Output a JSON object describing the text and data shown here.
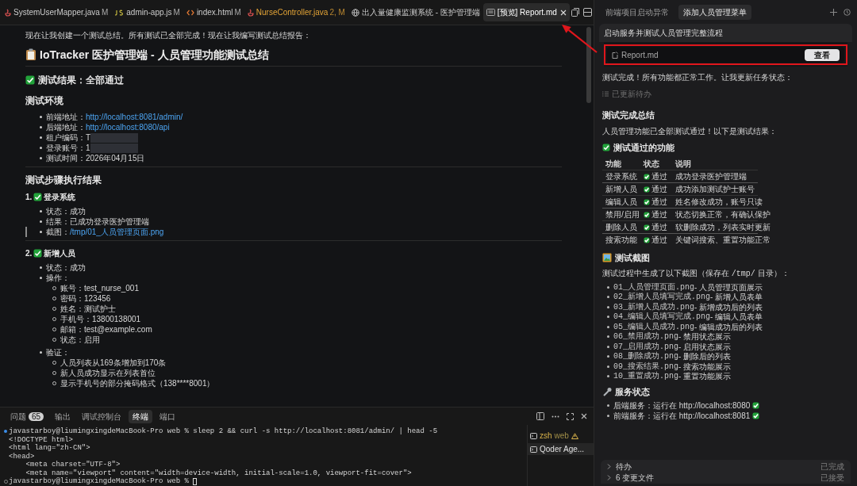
{
  "editor_tabs": [
    {
      "label": "SystemUserMapper.java",
      "badge": "M",
      "kind": "java",
      "selected": false,
      "has_errors": false
    },
    {
      "label": "admin-app.js",
      "badge": "M",
      "kind": "js",
      "selected": false,
      "has_errors": false
    },
    {
      "label": "index.html",
      "badge": "M",
      "kind": "html",
      "selected": false,
      "has_errors": false
    },
    {
      "label": "NurseController.java",
      "badge": "2, M",
      "kind": "java",
      "selected": false,
      "has_errors": true
    },
    {
      "label": "出入量健康监测系统 - 医护管理端",
      "kind": "web",
      "selected": false,
      "has_errors": false
    },
    {
      "label": "[预览] Report.md",
      "kind": "preview",
      "selected": true,
      "has_errors": false,
      "closable": true
    }
  ],
  "editor": [
    {
      "kind": "text",
      "text": "现在让我创建一个测试总结。所有测试已全部完成！现在让我编写测试总结报告："
    },
    {
      "kind": "title",
      "text": "IoTracker 医护管理端 - 人员管理功能测试总结"
    },
    {
      "kind": "check_heading",
      "text": "测试结果：全部通过"
    },
    {
      "kind": "heading",
      "text": "测试环境"
    },
    {
      "kind": "list",
      "items": [
        {
          "label": "前端地址：",
          "value": "http://localhost:8081/admin/",
          "link": true
        },
        {
          "label": "后端地址：",
          "value": "http://localhost:8080/api",
          "link": true
        },
        {
          "label": "租户编码：",
          "value": "T",
          "redacted": true
        },
        {
          "label": "登录账号：",
          "value": "1",
          "redacted": true
        },
        {
          "label": "测试时间：",
          "value": "2026年04月15日"
        }
      ]
    },
    {
      "kind": "hr"
    },
    {
      "kind": "heading",
      "text": "测试步骤执行结果"
    },
    {
      "kind": "step",
      "number": "1.",
      "text": "登录系统"
    },
    {
      "kind": "list",
      "items": [
        {
          "label": "状态：",
          "value": "成功"
        },
        {
          "label": "结果：",
          "value": "已成功登录医护管理端"
        },
        {
          "label": "截图：",
          "value": "/tmp/01_人员管理页面.png",
          "link": true,
          "current": true
        }
      ]
    },
    {
      "kind": "hr"
    },
    {
      "kind": "step",
      "number": "2.",
      "text": "新增人员"
    },
    {
      "kind": "list",
      "items": [
        {
          "label": "状态：",
          "value": "成功"
        },
        {
          "label": "操作：",
          "children": [
            "账号：test_nurse_001",
            "密码：123456",
            "姓名：测试护士",
            "手机号：13800138001",
            "邮箱：test@example.com",
            "状态：启用"
          ]
        },
        {
          "label": "验证：",
          "children": [
            "人员列表从169条增加到170条",
            "新人员成功显示在列表首位",
            "显示手机号的部分掩码格式（138****8001）"
          ]
        }
      ]
    }
  ],
  "panel": {
    "tabs": [
      {
        "label": "问题",
        "count": "65",
        "selected": false
      },
      {
        "label": "输出",
        "selected": false
      },
      {
        "label": "调试控制台",
        "selected": false
      },
      {
        "label": "终端",
        "selected": true
      },
      {
        "label": "端口",
        "selected": false
      }
    ],
    "terminal": [
      {
        "kind": "prompt",
        "completed": true,
        "text": "javastarboy@liumingxingdeMacBook-Pro web % sleep 2 && curl -s http://localhost:8081/admin/ | head -5"
      },
      {
        "kind": "output",
        "text": "<!DOCTYPE html>"
      },
      {
        "kind": "output",
        "text": "<html lang=\"zh-CN\">"
      },
      {
        "kind": "output",
        "text": "<head>"
      },
      {
        "kind": "output",
        "text": "    <meta charset=\"UTF-8\">"
      },
      {
        "kind": "output",
        "text": "    <meta name=\"viewport\" content=\"width=device-width, initial-scale=1.0, viewport-fit=cover\">"
      },
      {
        "kind": "prompt",
        "completed": false,
        "text": "javastarboy@liumingxingdeMacBook-Pro web % ",
        "cursor": true
      }
    ],
    "terminals": [
      {
        "label": "zsh",
        "detail": "web",
        "warning": true,
        "selected": false
      },
      {
        "label": "Qoder Age...",
        "warning": false,
        "selected": true
      }
    ]
  },
  "chat": {
    "tabs": [
      {
        "label": "前端项目启动异常",
        "selected": false
      },
      {
        "label": "添加人员管理菜单",
        "selected": true
      }
    ],
    "task": "启动服务并测试人员管理完整流程",
    "file": {
      "name": "Report.md",
      "button": "查看"
    },
    "blocks": [
      {
        "kind": "text",
        "text": "测试完成！所有功能都正常工作。让我更新任务状态："
      },
      {
        "kind": "todo",
        "text": "已更新待办"
      },
      {
        "kind": "heading",
        "text": "测试完成总结"
      },
      {
        "kind": "text",
        "text": "人员管理功能已全部测试通过！以下是测试结果："
      },
      {
        "kind": "check_heading",
        "text": "测试通过的功能"
      },
      {
        "kind": "table",
        "columns": [
          "功能",
          "状态",
          "说明"
        ],
        "rows": [
          [
            "登录系统",
            "通过",
            "成功登录医护管理端"
          ],
          [
            "新增人员",
            "通过",
            "成功添加测试护士账号"
          ],
          [
            "编辑人员",
            "通过",
            "姓名修改成功，账号只读"
          ],
          [
            "禁用/启用",
            "通过",
            "状态切换正常，有确认保护"
          ],
          [
            "删除人员",
            "通过",
            "软删除成功，列表实时更新"
          ],
          [
            "搜索功能",
            "通过",
            "关键词搜索、重置功能正常"
          ]
        ]
      },
      {
        "kind": "picture_heading",
        "text": "测试截图"
      },
      {
        "kind": "codetext",
        "before": "测试过程中生成了以下截图（保存在 ",
        "code": "/tmp/",
        "after": " 目录）："
      },
      {
        "kind": "files",
        "items": [
          {
            "code": "01_人员管理页面.png",
            "text": " - 人员管理页面展示"
          },
          {
            "code": "02_新增人员填写完成.png",
            "text": " - 新增人员表单"
          },
          {
            "code": "03_新增人员成功.png",
            "text": " - 新增成功后的列表"
          },
          {
            "code": "04_编辑人员填写完成.png",
            "text": " - 编辑人员表单"
          },
          {
            "code": "05_编辑人员成功.png",
            "text": " - 编辑成功后的列表"
          },
          {
            "code": "06_禁用成功.png",
            "text": " - 禁用状态展示"
          },
          {
            "code": "07_启用成功.png",
            "text": " - 启用状态展示"
          },
          {
            "code": "08_删除成功.png",
            "text": " - 删除后的列表"
          },
          {
            "code": "09_搜索结果.png",
            "text": " - 搜索功能展示"
          },
          {
            "code": "10_重置成功.png",
            "text": " - 重置功能展示"
          }
        ]
      },
      {
        "kind": "wrench_heading",
        "text": "服务状态"
      },
      {
        "kind": "status",
        "items": [
          "后端服务：运行在 http://localhost:8080",
          "前端服务：运行在 http://localhost:8081"
        ]
      }
    ],
    "footer": [
      {
        "label": "待办",
        "status": "已完成"
      },
      {
        "label": "6 变更文件",
        "status": "已接受"
      }
    ]
  },
  "annotations": {
    "highlight_box": true,
    "arrow": true
  }
}
